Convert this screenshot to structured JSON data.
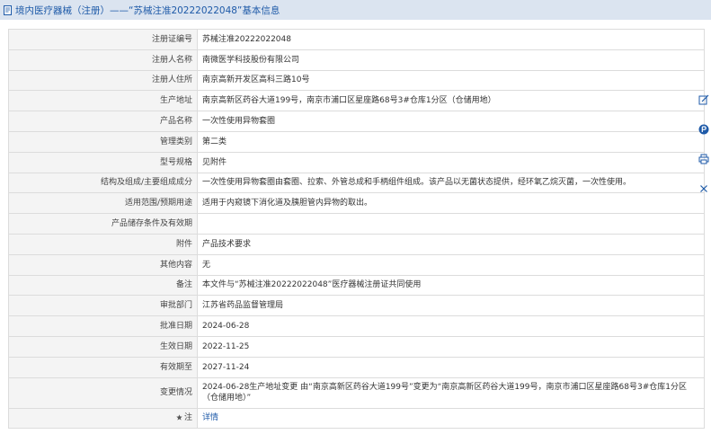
{
  "header": {
    "title": "境内医疗器械（注册）——“苏械注准20222022048”基本信息"
  },
  "rows": [
    {
      "label": "注册证编号",
      "value": "苏械注准20222022048"
    },
    {
      "label": "注册人名称",
      "value": "南微医学科技股份有限公司"
    },
    {
      "label": "注册人住所",
      "value": "南京高新开发区高科三路10号"
    },
    {
      "label": "生产地址",
      "value": "南京高新区药谷大道199号，南京市浦口区星座路68号3#仓库1分区（仓储用地）"
    },
    {
      "label": "产品名称",
      "value": "一次性使用异物套圈"
    },
    {
      "label": "管理类别",
      "value": "第二类"
    },
    {
      "label": "型号规格",
      "value": "见附件"
    },
    {
      "label": "结构及组成/主要组成成分",
      "value": "一次性使用异物套圈由套圈、拉索、外管总成和手柄组件组成。该产品以无菌状态提供，经环氧乙烷灭菌，一次性使用。"
    },
    {
      "label": "适用范围/预期用途",
      "value": "适用于内窥镜下消化道及胰胆管内异物的取出。"
    },
    {
      "label": "产品储存条件及有效期",
      "value": ""
    },
    {
      "label": "附件",
      "value": "产品技术要求"
    },
    {
      "label": "其他内容",
      "value": "无"
    },
    {
      "label": "备注",
      "value": "本文件与“苏械注准20222022048”医疗器械注册证共同使用"
    },
    {
      "label": "审批部门",
      "value": "江苏省药品监督管理局"
    },
    {
      "label": "批准日期",
      "value": "2024-06-28"
    },
    {
      "label": "生效日期",
      "value": "2022-11-25"
    },
    {
      "label": "有效期至",
      "value": "2027-11-24"
    },
    {
      "label": "变更情况",
      "value": "2024-06-28生产地址变更 由“南京高新区药谷大道199号”变更为“南京高新区药谷大道199号，南京市浦口区星座路68号3#仓库1分区（仓储用地）”"
    }
  ],
  "note_row": {
    "label": "注",
    "link": "详情"
  },
  "icons": {
    "title": "document-icon",
    "note": "star-icon",
    "tools": [
      "edit-icon",
      "favorite-icon",
      "print-icon",
      "close-icon"
    ]
  },
  "colors": {
    "accent": "#1e5aa8",
    "header_bg": "#dbe4f0",
    "label_bg": "#f4f4f4",
    "border": "#dcdcdc"
  }
}
